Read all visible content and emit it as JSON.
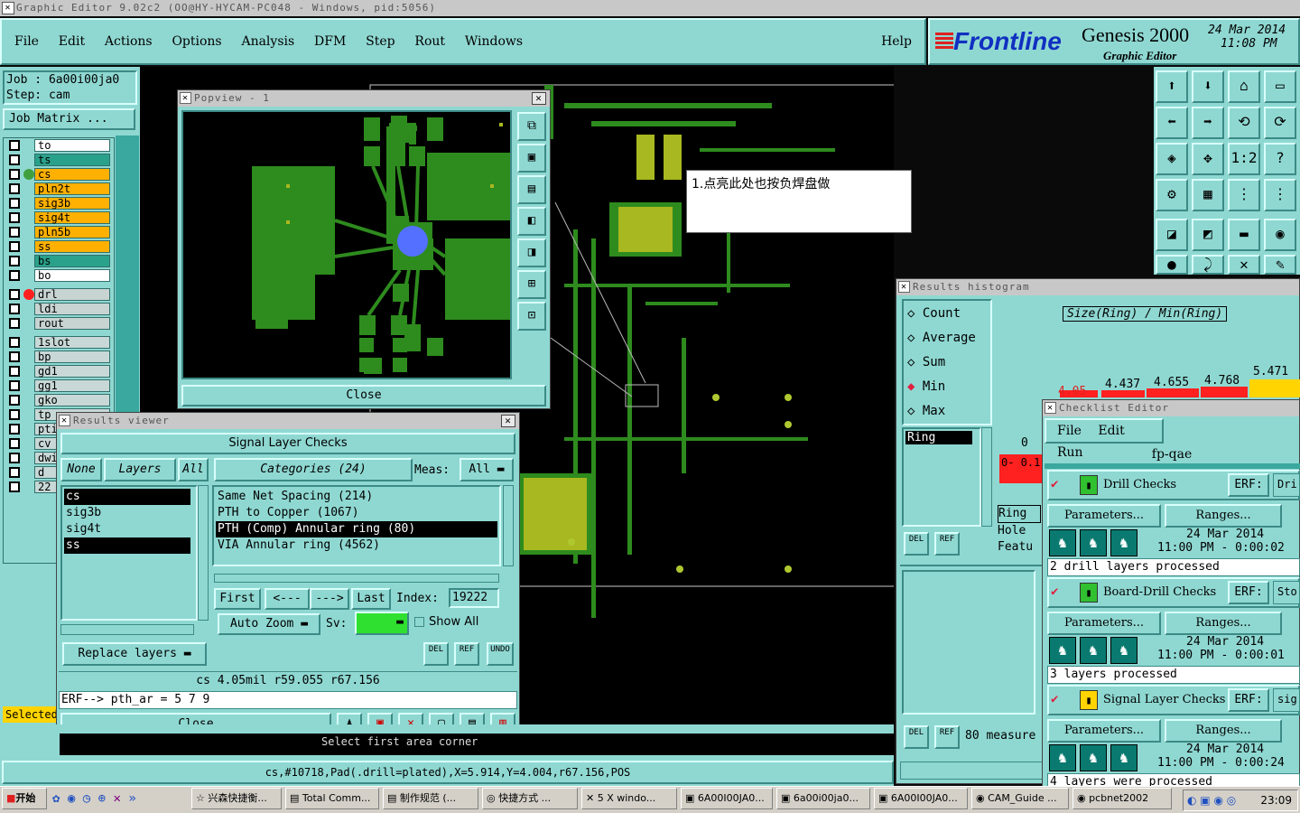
{
  "window_title": "Graphic Editor 9.02c2 (OO@HY-HYCAM-PC048 - Windows, pid:5056)",
  "menu": [
    "File",
    "Edit",
    "Actions",
    "Options",
    "Analysis",
    "DFM",
    "Step",
    "Rout",
    "Windows"
  ],
  "help": "Help",
  "brand": {
    "logo": "Frontline",
    "product": "Genesis 2000",
    "subtitle": "Graphic Editor",
    "date": "24 Mar 2014",
    "time": "11:08 PM"
  },
  "job": {
    "job": "Job : 6a00i00ja0",
    "step": "Step: cam",
    "matrix_btn": "Job Matrix ..."
  },
  "layers_top": [
    "to",
    "ts",
    "cs",
    "pln2t",
    "sig3b",
    "sig4t",
    "pln5b",
    "ss",
    "bs",
    "bo"
  ],
  "layers_mid": [
    "drl",
    "ldi",
    "rout"
  ],
  "layers_bot": [
    "1slot",
    "bp",
    "gd1",
    "gg1",
    "gko",
    "tp",
    "pti",
    "cv",
    "dwi",
    "d",
    "22"
  ],
  "selected_label": "Selected",
  "popview": {
    "title": "Popview - 1",
    "close": "Close"
  },
  "annotation": "1.点亮此处也按负焊盘做",
  "results_viewer": {
    "title": "Results viewer",
    "header": "Signal Layer Checks",
    "btn_none": "None",
    "btn_layers": "Layers",
    "btn_all": "All",
    "categories": "Categories (24)",
    "meas_label": "Meas:",
    "meas_value": "All",
    "layer_list": [
      "cs",
      "sig3b",
      "sig4t",
      "ss"
    ],
    "category_list": [
      "Same Net Spacing (214)",
      "PTH to Copper (1067)",
      "PTH (Comp) Annular ring (80)",
      "VIA Annular ring (4562)"
    ],
    "nav": [
      "First",
      "<---",
      "--->",
      "Last"
    ],
    "index_label": "Index:",
    "index_value": "19222",
    "auto_zoom": "Auto Zoom",
    "sv_label": "Sv:",
    "show_all": "Show All",
    "replace_layers": "Replace layers",
    "del": "DEL",
    "ref": "REF",
    "undo": "UNDO",
    "measure": "cs 4.05mil   r59.055   r67.156",
    "erf": "ERF--> pth_ar = 5 7 9",
    "close": "Close"
  },
  "histogram": {
    "title": "Results histogram",
    "options": [
      "Count",
      "Average",
      "Sum",
      "Min",
      "Max"
    ],
    "selected": "Min",
    "heading": "Size(Ring) / Min(Ring)",
    "list": [
      "Ring"
    ],
    "list2": [
      "Ring",
      "Hole",
      "Featu"
    ],
    "bin_values": [
      "4.05",
      "4.437",
      "4.655",
      "4.768",
      "5.471"
    ],
    "axis_zero": "0",
    "range": "0-\n0.1",
    "measure_btn": "80 measure",
    "del": "DEL",
    "ref": "REF"
  },
  "checklist": {
    "title": "Checklist Editor",
    "menu": [
      "File",
      "Edit",
      "Run"
    ],
    "name": "fp-qae",
    "rows": [
      {
        "name": "Drill Checks",
        "erf": "ERF:",
        "erf_val": "Dri",
        "params": "Parameters...",
        "ranges": "Ranges...",
        "date": "24 Mar 2014",
        "time": "11:00 PM - 0:00:02",
        "status": "2 drill layers processed"
      },
      {
        "name": "Board-Drill Checks",
        "erf": "ERF:",
        "erf_val": "Sto",
        "params": "Parameters...",
        "ranges": "Ranges...",
        "date": "24 Mar 2014",
        "time": "11:00 PM - 0:00:01",
        "status": "3 layers processed"
      },
      {
        "name": "Signal Layer Checks",
        "erf": "ERF:",
        "erf_val": "sig",
        "params": "Parameters...",
        "ranges": "Ranges...",
        "date": "24 Mar 2014",
        "time": "11:00 PM - 0:00:24",
        "status": "4 layers were processed"
      }
    ]
  },
  "status_bar": "cs,#10718,Pad(.drill=plated),X=5.914,Y=4.004,r67.156,POS",
  "prompt": "Select first area corner",
  "taskbar": {
    "start": "开始",
    "items": [
      "兴森快捷衡...",
      "Total Comm...",
      "制作规范 (...",
      "快捷方式 ...",
      "5 X windo...",
      "6A00I00JA0...",
      "6a00i00ja0...",
      "6A00I00JA0...",
      "CAM_Guide ...",
      "pcbnet2002"
    ],
    "clock": "23:09"
  },
  "colors": {
    "panel": "#8fd8d2",
    "pcb_green": "#2e8b1e",
    "pad_blue": "#5470ff",
    "yellow": "#ffd400",
    "red": "#ff2020"
  }
}
